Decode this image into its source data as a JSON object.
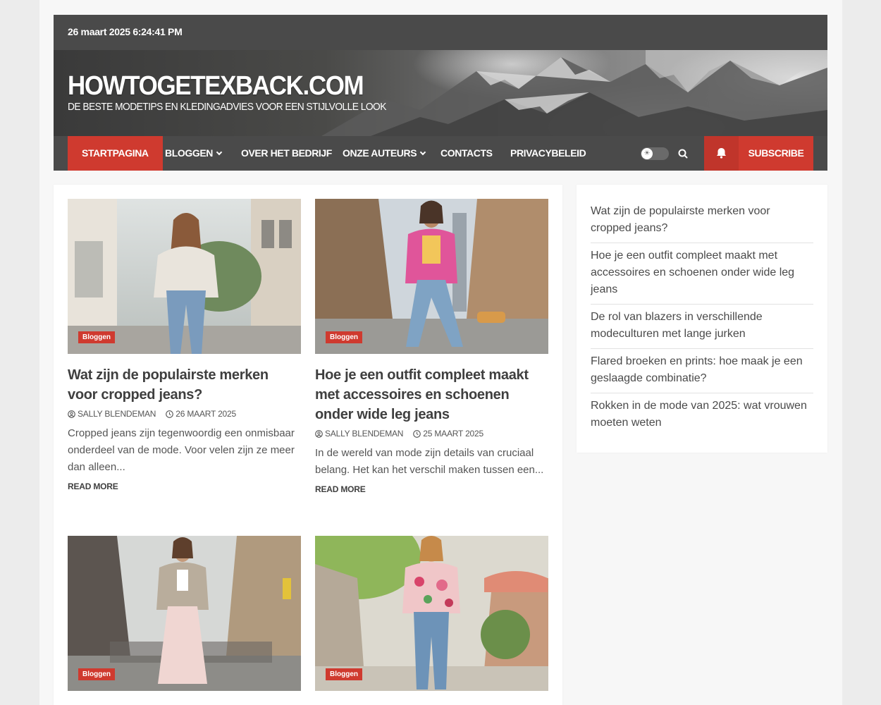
{
  "topbar": {
    "datetime": "26 maart 2025 6:24:41 PM"
  },
  "header": {
    "site_title": "HOWTOGETEXBACK.COM",
    "tagline": "DE BESTE MODETIPS EN KLEDINGADVIES VOOR EEN STIJLVOLLE LOOK"
  },
  "nav": {
    "items": [
      {
        "label": "STARTPAGINA",
        "active": true
      },
      {
        "label": "BLOGGEN",
        "dropdown": true
      },
      {
        "label": "OVER HET BEDRIJF"
      },
      {
        "label": "ONZE AUTEURS",
        "dropdown": true
      },
      {
        "label": "CONTACTS"
      },
      {
        "label": "PRIVACYBELEID"
      }
    ],
    "subscribe_label": "SUBSCRIBE",
    "icons": {
      "dark_mode": "sun-toggle-icon",
      "search": "search-icon",
      "notify": "bell-icon"
    }
  },
  "posts": [
    {
      "category": "Bloggen",
      "title": "Wat zijn de populairste merken voor cropped jeans?",
      "author": "SALLY BLENDEMAN",
      "date": "26 MAART 2025",
      "excerpt": "Cropped jeans zijn tegenwoordig een onmisbaar onderdeel van de mode. Voor velen zijn ze meer dan alleen...",
      "read_more": "READ MORE"
    },
    {
      "category": "Bloggen",
      "title": "Hoe je een outfit compleet maakt met accessoires en schoenen onder wide leg jeans",
      "author": "SALLY BLENDEMAN",
      "date": "25 MAART 2025",
      "excerpt": "In de wereld van mode zijn details van cruciaal belang. Het kan het verschil maken tussen een...",
      "read_more": "READ MORE"
    },
    {
      "category": "Bloggen"
    },
    {
      "category": "Bloggen"
    }
  ],
  "sidebar": {
    "items": [
      "Wat zijn de populairste merken voor cropped jeans?",
      "Hoe je een outfit compleet maakt met accessoires en schoenen onder wide leg jeans",
      "De rol van blazers in verschillende modeculturen met lange jurken",
      "Flared broeken en prints: hoe maak je een geslaagde combinatie?",
      "Rokken in de mode van 2025: wat vrouwen moeten weten"
    ]
  },
  "colors": {
    "accent": "#cf3a2f",
    "bar": "#4a4a4a"
  }
}
